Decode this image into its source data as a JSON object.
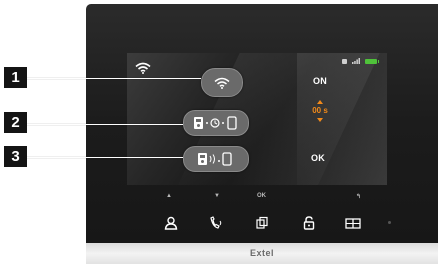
{
  "screen": {
    "status": {
      "wifi_icon": "wifi-icon",
      "right_icons": [
        "message-icon",
        "signal-icon",
        "battery-icon"
      ],
      "battery_color": "#4fc23a"
    },
    "rows": [
      {
        "number": "1",
        "button_icon": "wifi-icon",
        "value": "ON"
      },
      {
        "number": "2",
        "button_icon": "monitor-timer-icon",
        "value": "00 s"
      },
      {
        "number": "3",
        "button_icon": "monitor-ring-icon",
        "value": "OK"
      }
    ],
    "accent_color": "#f28a1a",
    "softkeys": [
      "▲",
      "▼",
      "OK",
      "↰"
    ]
  },
  "hardware_buttons": [
    "person-icon",
    "intercom-call-icon",
    "copy-icon",
    "unlock-icon",
    "gate-icon"
  ],
  "brand": "Extel"
}
